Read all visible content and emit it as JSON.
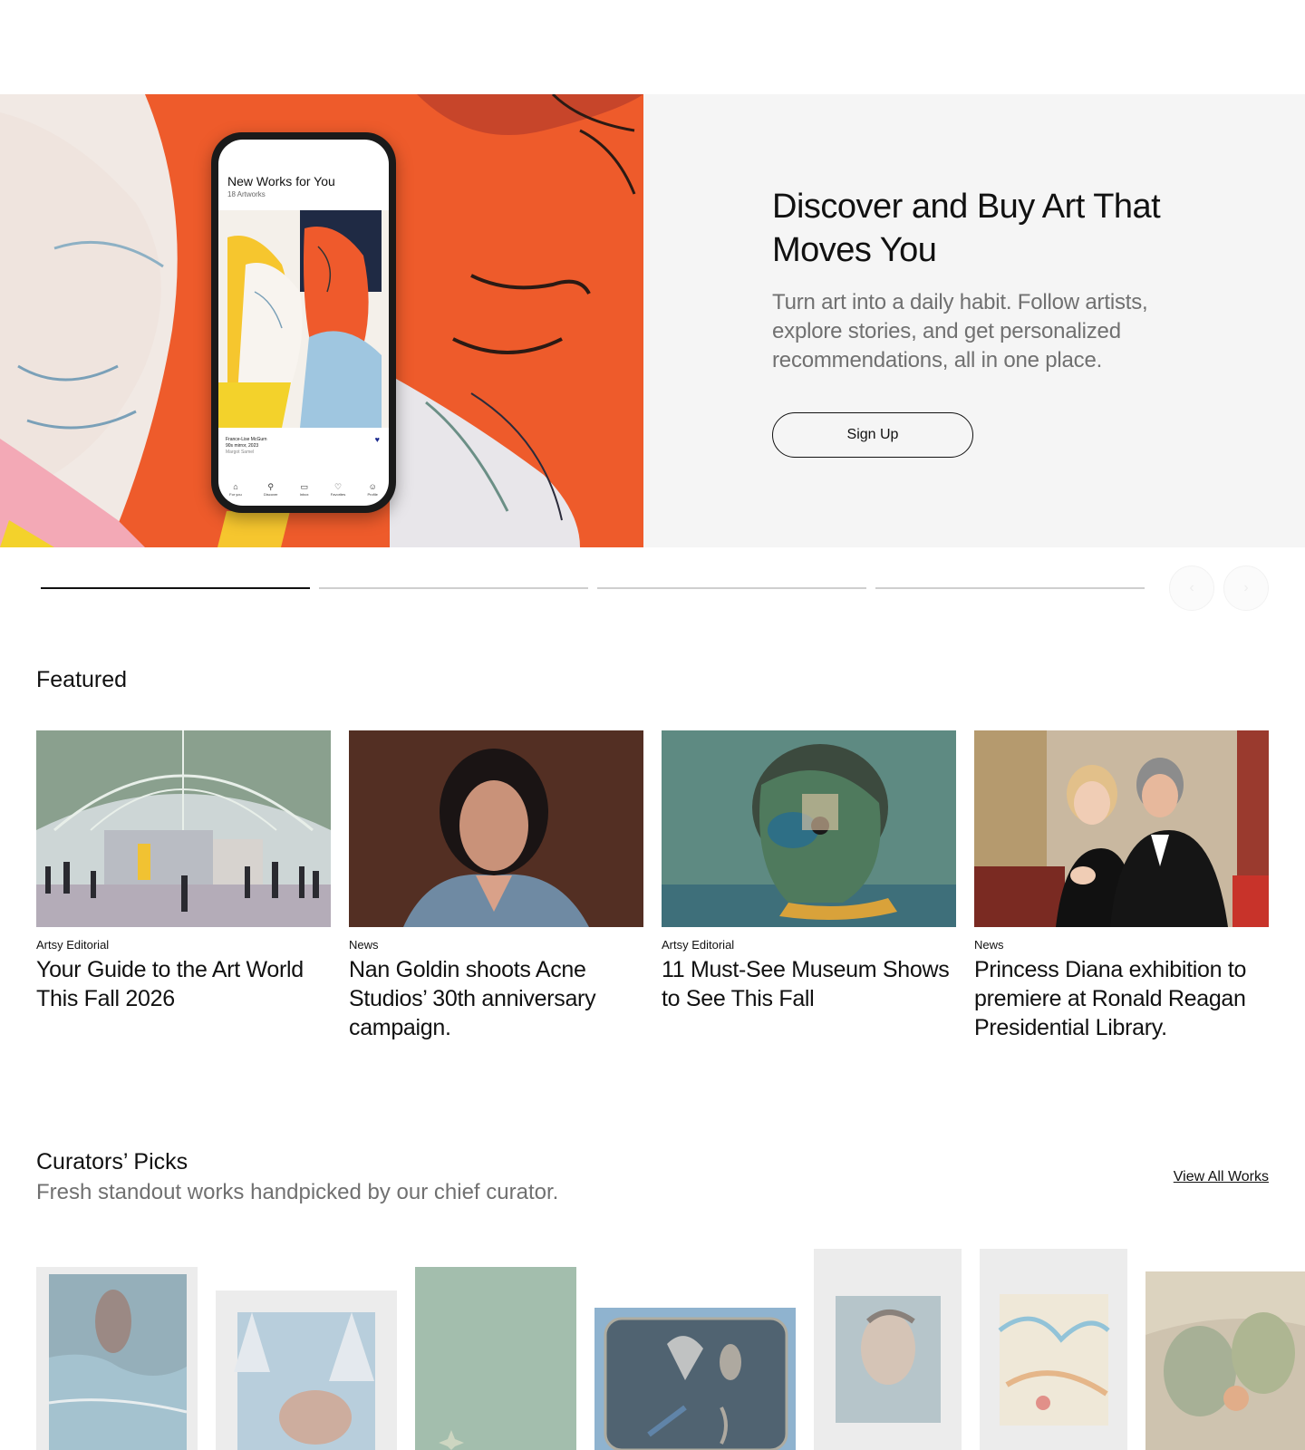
{
  "hero": {
    "title": "Discover and Buy Art That Moves You",
    "subtitle": "Turn art into a daily habit. Follow artists, explore stories, and get personalized recommendations, all in one place.",
    "cta_label": "Sign Up",
    "phone": {
      "title": "New Works for You",
      "count": "18 Artworks",
      "artist_sub": "Margot Samel",
      "caption_artist": "France-Lise McGurn",
      "caption_work": "90s mirror, 2023",
      "caption_gallery": "Margot Samel",
      "nav": [
        {
          "label": "For you",
          "icon": "home-icon"
        },
        {
          "label": "Discover",
          "icon": "search-icon"
        },
        {
          "label": "Inbox",
          "icon": "chat-icon"
        },
        {
          "label": "Favorites",
          "icon": "heart-icon"
        },
        {
          "label": "Profile",
          "icon": "user-icon"
        }
      ]
    }
  },
  "carousel": {
    "active_index": 0,
    "count": 4
  },
  "featured": {
    "heading": "Featured",
    "cards": [
      {
        "category": "Artsy Editorial",
        "title": "Your Guide to the Art World This Fall 2026"
      },
      {
        "category": "News",
        "title": "Nan Goldin shoots Acne Studios’ 30th anniversary campaign."
      },
      {
        "category": "Artsy Editorial",
        "title": "11 Must-See Museum Shows to See This Fall"
      },
      {
        "category": "News",
        "title": "Princess Diana exhibition to premiere at Ronald Reagan Presidential Library."
      }
    ]
  },
  "curators": {
    "heading": "Curators’ Picks",
    "subtitle": "Fresh standout works handpicked by our chief curator.",
    "view_all": "View All Works"
  },
  "colors": {
    "hero_orange": "#ef5a2c",
    "panel_bg": "#f5f5f5",
    "muted_text": "#707070"
  }
}
